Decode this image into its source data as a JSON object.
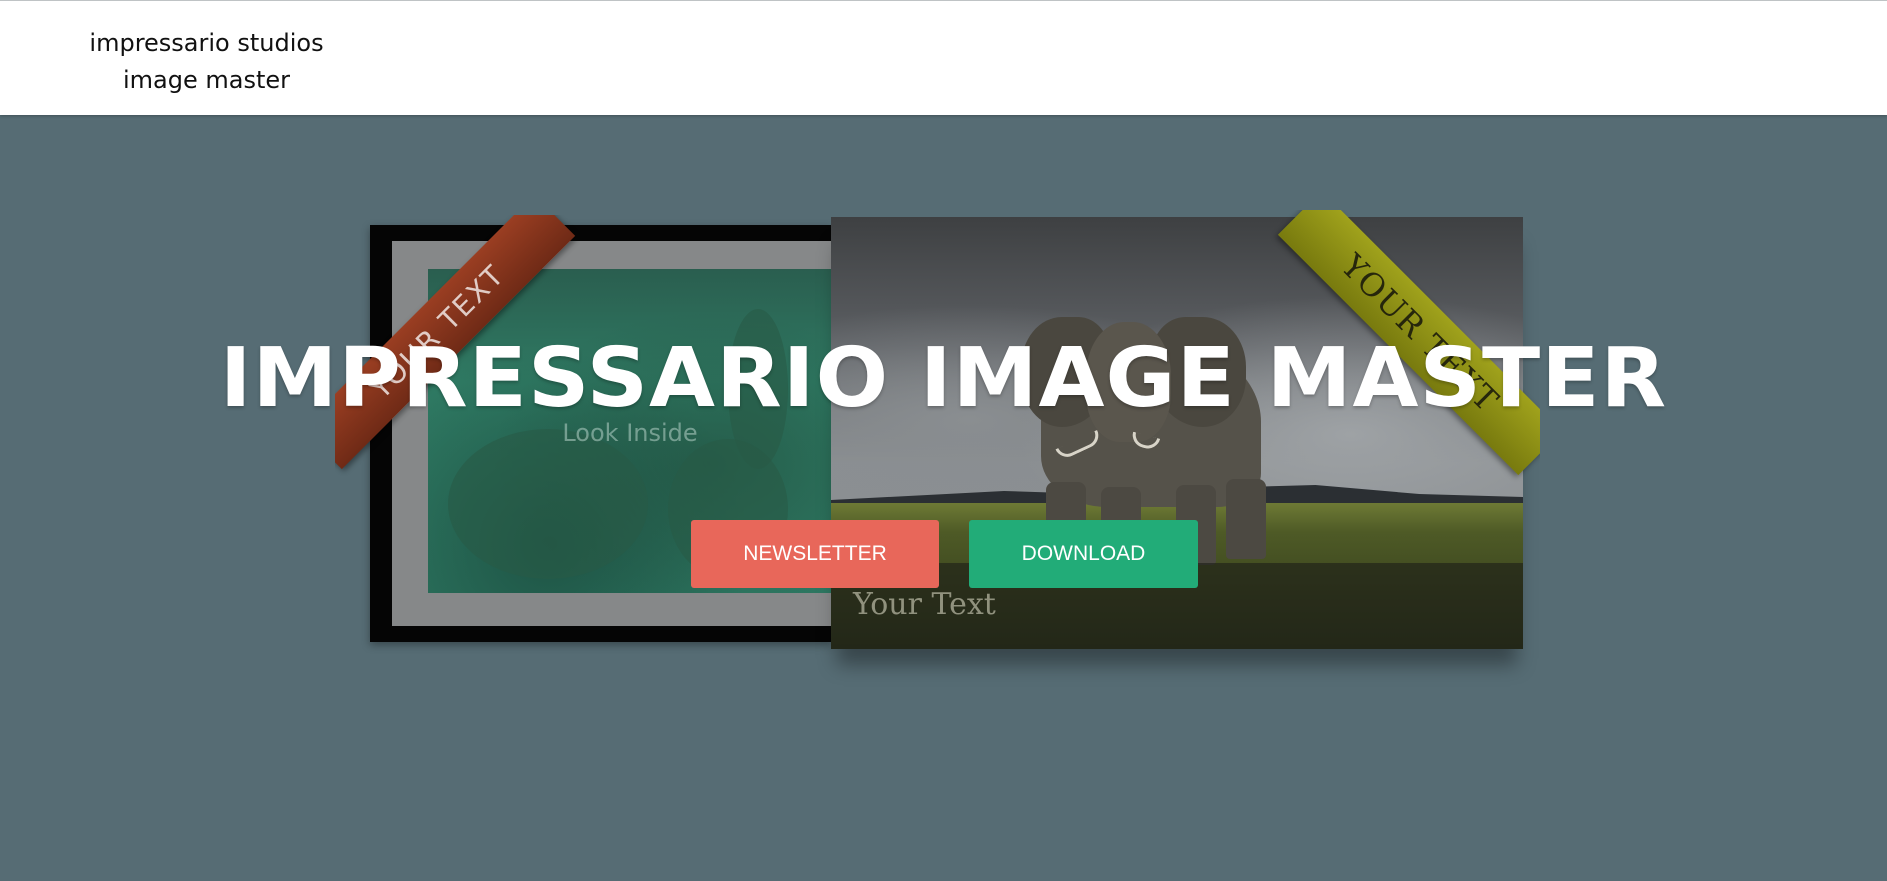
{
  "header": {
    "brand_line1": "impressario studios",
    "brand_line2": "image master"
  },
  "hero": {
    "headline": "IMPRESSARIO IMAGE MASTER",
    "left_image": {
      "ribbon_text": "YOUR TEXT",
      "caption": "Look Inside",
      "ribbon_color": "#8a3a1e"
    },
    "right_image": {
      "ribbon_text": "YOUR TEXT",
      "caption": "Your Text",
      "ribbon_color": "#8f9112"
    },
    "buttons": {
      "newsletter_label": "NEWSLETTER",
      "download_label": "DOWNLOAD"
    }
  },
  "colors": {
    "background": "#566c74",
    "header_bg": "#ffffff",
    "newsletter": "#e8675a",
    "download": "#22ac78"
  }
}
